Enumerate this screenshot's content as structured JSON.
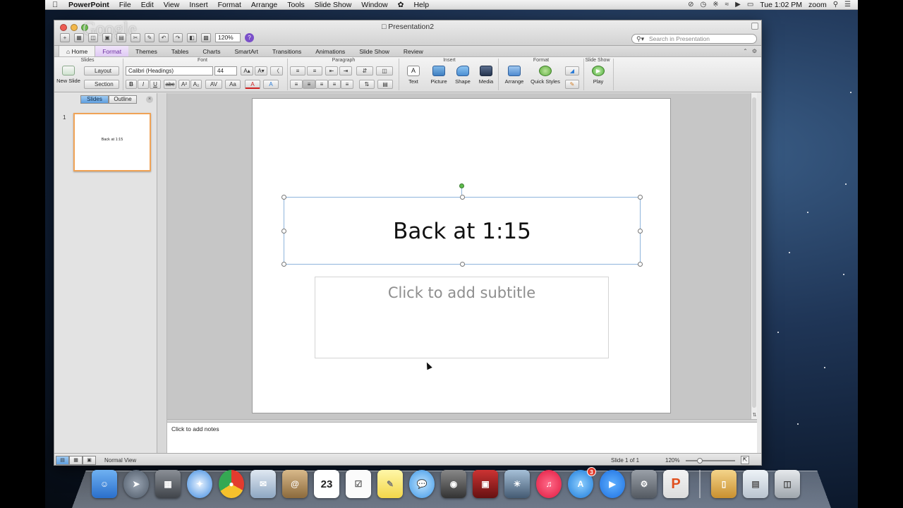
{
  "menubar": {
    "app": "PowerPoint",
    "items": [
      "File",
      "Edit",
      "View",
      "Insert",
      "Format",
      "Arrange",
      "Tools",
      "Slide Show",
      "Window",
      "Help"
    ],
    "clock": "Tue 1:02 PM",
    "user": "zoom"
  },
  "window": {
    "title": "Presentation2",
    "watermark": "Google",
    "zoom": "120%",
    "search_placeholder": "Search in Presentation"
  },
  "ribbon": {
    "tabs": [
      "Home",
      "Format",
      "Themes",
      "Tables",
      "Charts",
      "SmartArt",
      "Transitions",
      "Animations",
      "Slide Show",
      "Review"
    ],
    "groups": {
      "slides": "Slides",
      "font": "Font",
      "paragraph": "Paragraph",
      "insert": "Insert",
      "format": "Format",
      "slideshow": "Slide Show"
    },
    "new_slide": "New Slide",
    "layout": "Layout",
    "section": "Section",
    "font_name": "Calibri (Headings)",
    "font_size": "44",
    "insert_buttons": [
      "Text",
      "Picture",
      "Shape",
      "Media"
    ],
    "format_buttons": [
      "Arrange",
      "Quick Styles"
    ],
    "play": "Play"
  },
  "left_pane": {
    "tabs": [
      "Slides",
      "Outline"
    ],
    "slide_number": "1",
    "thumb_title": "Back at 1:15"
  },
  "slide": {
    "title": "Back at 1:15",
    "subtitle_placeholder": "Click to add subtitle"
  },
  "notes": {
    "placeholder": "Click to add notes"
  },
  "status": {
    "view": "Normal View",
    "slide_indicator": "Slide 1 of 1",
    "zoom": "120%"
  },
  "dock": {
    "calendar_day": "23",
    "appstore_badge": "3"
  },
  "colors": {
    "format_tab": "#6b2fa0",
    "selection_border": "#8fb4dc",
    "thumb_border": "#f0a356"
  }
}
